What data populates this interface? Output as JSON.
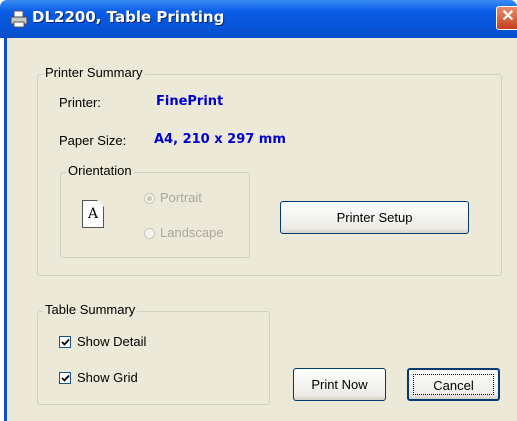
{
  "window": {
    "title": "DL2200, Table Printing",
    "close_glyph": "✕"
  },
  "printer_summary": {
    "legend": "Printer Summary",
    "printer_label": "Printer:",
    "printer_value": "FinePrint",
    "paper_label": "Paper Size:",
    "paper_value": "A4, 210 x 297 mm",
    "orientation": {
      "legend": "Orientation",
      "page_glyph": "A",
      "portrait_label": "Portrait",
      "landscape_label": "Landscape",
      "selected": "Portrait"
    },
    "setup_button": "Printer Setup"
  },
  "table_summary": {
    "legend": "Table Summary",
    "show_detail_label": "Show Detail",
    "show_detail_checked": true,
    "show_grid_label": "Show Grid",
    "show_grid_checked": true
  },
  "buttons": {
    "print_now": "Print Now",
    "cancel": "Cancel"
  },
  "colors": {
    "title_bar": "#0a5de6",
    "value_text": "#0000cc",
    "dialog_bg": "#ece9d8"
  }
}
